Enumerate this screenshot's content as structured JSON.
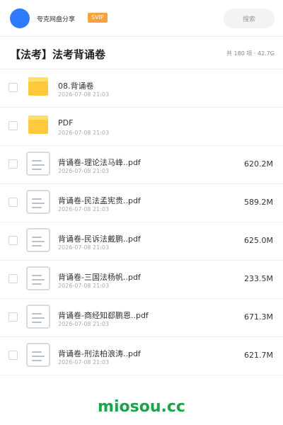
{
  "header": {
    "app_name": "夸克网盘分享",
    "vip_badge": "SVIP",
    "search_placeholder": "搜索",
    "colors": {
      "avatar": "#2f7bff",
      "vip": "#f7a23b"
    }
  },
  "folder": {
    "title": "【法考】法考背诵卷",
    "stats": "共 180 项 · 42.7G"
  },
  "files": [
    {
      "name": "08.背诵卷",
      "date": "2026-07-08 21:03",
      "size": "",
      "icon": "folder-icon"
    },
    {
      "name": "PDF",
      "date": "2026-07-08 21:03",
      "size": "",
      "icon": "folder-icon"
    },
    {
      "name": "背诵卷-理论法马峰..pdf",
      "date": "2026-07-08 21:03",
      "size": "620.2M",
      "icon": "document-icon"
    },
    {
      "name": "背诵卷-民法孟宪贵..pdf",
      "date": "2026-07-08 21:03",
      "size": "589.2M",
      "icon": "document-icon"
    },
    {
      "name": "背诵卷-民诉法戴鹏..pdf",
      "date": "2026-07-08 21:03",
      "size": "625.0M",
      "icon": "document-icon"
    },
    {
      "name": "背诵卷-三国法杨帆..pdf",
      "date": "2026-07-08 21:03",
      "size": "233.5M",
      "icon": "document-icon"
    },
    {
      "name": "背诵卷-商经知郄鹏恩..pdf",
      "date": "2026-07-08 21:03",
      "size": "671.3M",
      "icon": "document-icon"
    },
    {
      "name": "背诵卷-刑法柏浪涛..pdf",
      "date": "2026-07-08 21:03",
      "size": "621.7M",
      "icon": "document-icon"
    }
  ],
  "watermark": {
    "text": "miosou.cc",
    "color": "#1aa34a"
  }
}
